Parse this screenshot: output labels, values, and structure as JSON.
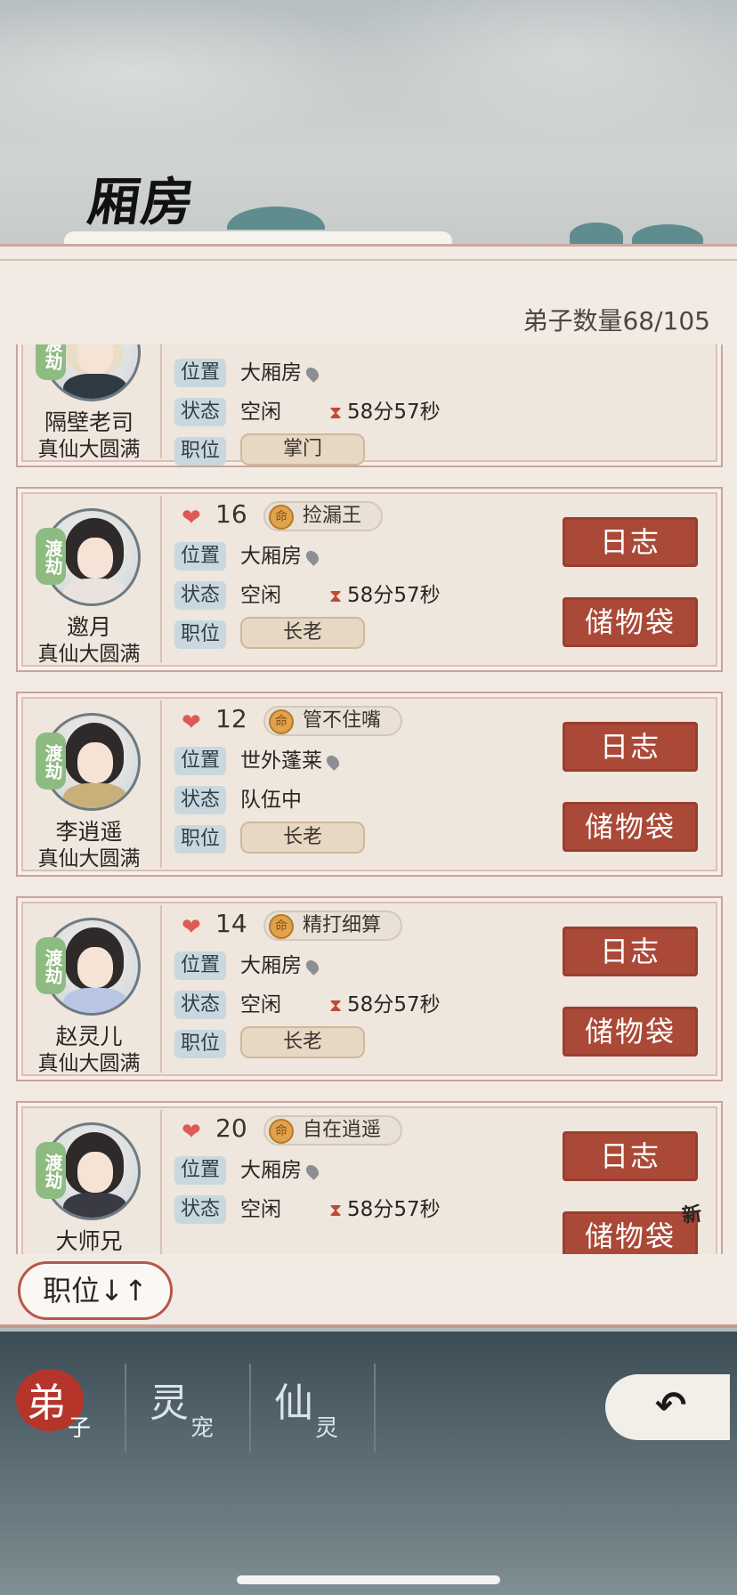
{
  "header": {
    "title": "厢房"
  },
  "summary": {
    "disciple_count": "弟子数量68/105"
  },
  "labels": {
    "location": "位置",
    "status": "状态",
    "role": "职位",
    "log": "日志",
    "bag": "储物袋",
    "new": "新",
    "seal": "渡劫"
  },
  "disciples": [
    {
      "name": "隔壁老司",
      "realm": "真仙大圆满",
      "location": "大厢房",
      "status": "空闲",
      "timer": "58分57秒",
      "role": "掌门"
    },
    {
      "name": "邀月",
      "realm": "真仙大圆满",
      "favor": "16",
      "trait": "捡漏王",
      "location": "大厢房",
      "status": "空闲",
      "timer": "58分57秒",
      "role": "长老"
    },
    {
      "name": "李逍遥",
      "realm": "真仙大圆满",
      "favor": "12",
      "trait": "管不住嘴",
      "location": "世外蓬莱",
      "status": "队伍中",
      "timer": "",
      "role": "长老"
    },
    {
      "name": "赵灵儿",
      "realm": "真仙大圆满",
      "favor": "14",
      "trait": "精打细算",
      "location": "大厢房",
      "status": "空闲",
      "timer": "58分57秒",
      "role": "长老"
    },
    {
      "name": "大师兄",
      "realm": "",
      "favor": "20",
      "trait": "自在逍遥",
      "location": "大厢房",
      "status": "空闲",
      "timer": "58分57秒",
      "role": ""
    }
  ],
  "sort": {
    "label": "职位↓↑"
  },
  "nav": {
    "tabs": [
      {
        "big": "弟",
        "small": "子"
      },
      {
        "big": "灵",
        "small": "宠"
      },
      {
        "big": "仙",
        "small": "灵"
      }
    ],
    "back_icon": "back-arrow-icon"
  },
  "colors": {
    "accent_red": "#ab4938",
    "panel_bg": "#f1ebe3",
    "label_blue": "#c9d8df"
  }
}
